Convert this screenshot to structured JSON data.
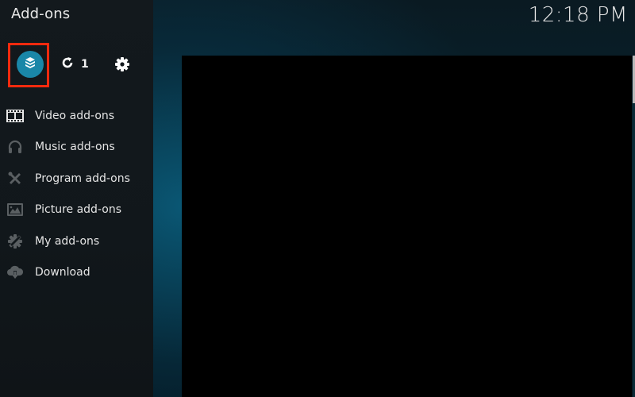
{
  "header": {
    "title": "Add-ons",
    "clock": "12:18 PM"
  },
  "toolbar": {
    "addon_browser_icon": "open-box-icon",
    "update_icon": "refresh-icon",
    "update_count": "1",
    "settings_icon": "gear-icon",
    "focused_item": "addon-browser",
    "accent_color": "#1a87a8",
    "focus_color": "#ff2a0e"
  },
  "menu": {
    "items": [
      {
        "label": "Video add-ons",
        "icon": "film-strip-icon"
      },
      {
        "label": "Music add-ons",
        "icon": "headphones-icon"
      },
      {
        "label": "Program add-ons",
        "icon": "tools-icon"
      },
      {
        "label": "Picture add-ons",
        "icon": "picture-icon"
      },
      {
        "label": "My add-ons",
        "icon": "gear-wrench-icon"
      },
      {
        "label": "Download",
        "icon": "cloud-download-icon"
      }
    ]
  }
}
